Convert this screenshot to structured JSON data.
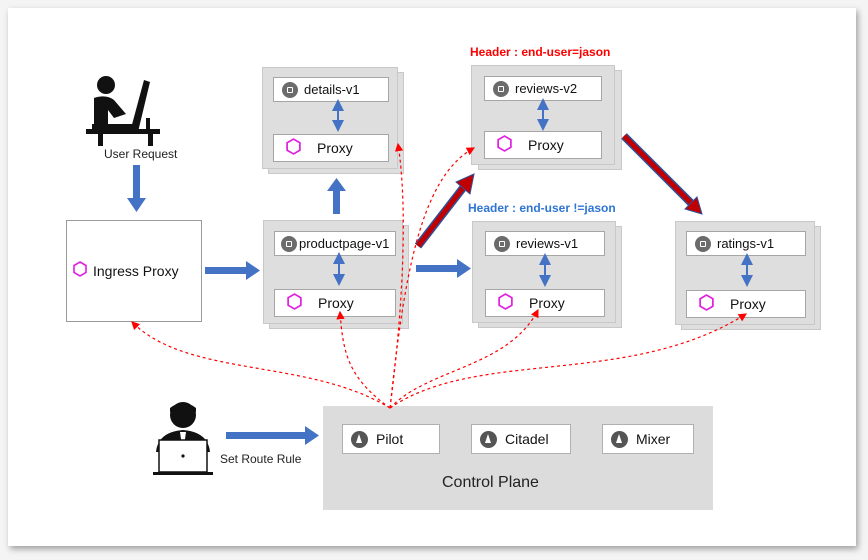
{
  "headers": {
    "reviews_v2_rule": "Header : end-user=jason",
    "reviews_v1_rule": "Header : end-user !=jason"
  },
  "user_request_label": "User Request",
  "set_route_rule_label": "Set Route Rule",
  "ingress": {
    "label": "Ingress Proxy"
  },
  "pods": {
    "details": {
      "service": "details-v1",
      "proxy": "Proxy"
    },
    "reviews_v2": {
      "service": "reviews-v2",
      "proxy": "Proxy"
    },
    "productpage": {
      "service": "productpage-v1",
      "proxy": "Proxy"
    },
    "reviews_v1": {
      "service": "reviews-v1",
      "proxy": "Proxy"
    },
    "ratings": {
      "service": "ratings-v1",
      "proxy": "Proxy"
    }
  },
  "control_plane": {
    "title": "Control Plane",
    "components": [
      "Pilot",
      "Citadel",
      "Mixer"
    ]
  },
  "colors": {
    "header_red": "#ff0000",
    "header_blue": "#2e75d6",
    "flow_arrow": "#4472c4",
    "route_arrow": "#c00000",
    "config_dashed": "#ff0000",
    "proxy_hexagon": "#e020e0"
  },
  "icons": [
    "user-at-computer-icon",
    "admin-laptop-icon",
    "chip-icon",
    "hexagon-proxy-icon",
    "sail-icon"
  ]
}
